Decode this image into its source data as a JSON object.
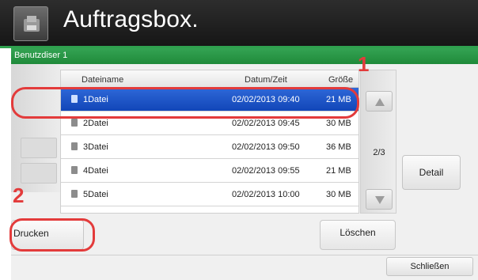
{
  "header": {
    "title": "Auftragsbox."
  },
  "user_bar": {
    "label": "Benutzdiser 1"
  },
  "file_list": {
    "columns": {
      "name": "Dateiname",
      "date": "Datum/Zeit",
      "size": "Größe"
    },
    "rows": [
      {
        "name": "1Datei",
        "date": "02/02/2013 09:40",
        "size": "21 MB",
        "selected": true
      },
      {
        "name": "2Datei",
        "date": "02/02/2013 09:45",
        "size": "30 MB",
        "selected": false
      },
      {
        "name": "3Datei",
        "date": "02/02/2013 09:50",
        "size": "36 MB",
        "selected": false
      },
      {
        "name": "4Datei",
        "date": "02/02/2013 09:55",
        "size": "21 MB",
        "selected": false
      },
      {
        "name": "5Datei",
        "date": "02/02/2013 10:00",
        "size": "30 MB",
        "selected": false
      }
    ]
  },
  "pager": {
    "page": "2/3"
  },
  "buttons": {
    "detail": "Detail",
    "print": "Drucken",
    "delete": "Löschen",
    "close": "Schließen"
  },
  "callouts": {
    "one": "1",
    "two": "2"
  },
  "colors": {
    "accent_green": "#2fa04e",
    "selection_blue": "#1d55c8",
    "callout_red": "#e33b3b"
  }
}
